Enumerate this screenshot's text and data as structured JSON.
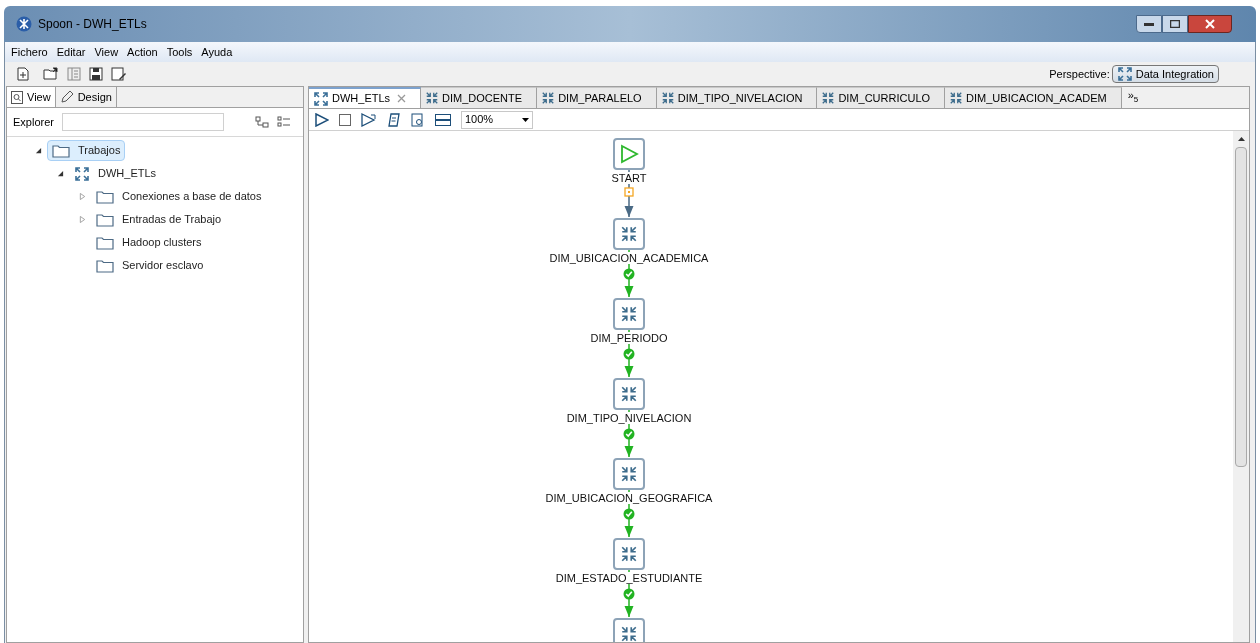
{
  "window": {
    "title": "Spoon - DWH_ETLs"
  },
  "menu": [
    "Fichero",
    "Editar",
    "View",
    "Action",
    "Tools",
    "Ayuda"
  ],
  "perspective": {
    "label": "Perspective:",
    "button": "Data Integration"
  },
  "left_tabs": [
    {
      "label": "View",
      "kind": "search",
      "selected": true
    },
    {
      "label": "Design",
      "kind": "pencil",
      "selected": false
    }
  ],
  "explorer": {
    "label": "Explorer"
  },
  "tree": [
    {
      "label": "Trabajos",
      "kind": "folder",
      "expanded": true,
      "selected": true,
      "children": [
        {
          "label": "DWH_ETLs",
          "kind": "job",
          "expanded": true,
          "selected": false,
          "children": [
            {
              "label": "Conexiones a base de datos",
              "kind": "folder",
              "expanded": false,
              "selected": false
            },
            {
              "label": "Entradas de Trabajo",
              "kind": "folder",
              "expanded": false,
              "selected": false
            },
            {
              "label": "Hadoop clusters",
              "kind": "folder",
              "selected": false
            },
            {
              "label": "Servidor esclavo",
              "kind": "folder",
              "selected": false
            }
          ]
        }
      ]
    }
  ],
  "tabs": [
    {
      "label": "DWH_ETLs",
      "kind": "job",
      "closable": true,
      "selected": true
    },
    {
      "label": "DIM_DOCENTE",
      "kind": "transform",
      "closable": false,
      "selected": false
    },
    {
      "label": "DIM_PARALELO",
      "kind": "transform",
      "closable": false,
      "selected": false
    },
    {
      "label": "DIM_TIPO_NIVELACION",
      "kind": "transform",
      "closable": false,
      "selected": false
    },
    {
      "label": "DIM_CURRICULO",
      "kind": "transform",
      "closable": false,
      "selected": false
    },
    {
      "label": "DIM_UBICACION_ACADEM",
      "kind": "transform",
      "closable": false,
      "selected": false
    }
  ],
  "tabs_overflow": {
    "symbol": "»",
    "count": "5"
  },
  "zoom": {
    "value": "100%"
  },
  "nodes": [
    {
      "kind": "start",
      "label": "START",
      "hop": {
        "kind": "unconditional"
      }
    },
    {
      "kind": "transform",
      "label": "DIM_UBICACION_ACADEMICA",
      "hop": {
        "kind": "success"
      }
    },
    {
      "kind": "transform",
      "label": "DIM_PERIODO",
      "hop": {
        "kind": "success"
      }
    },
    {
      "kind": "transform",
      "label": "DIM_TIPO_NIVELACION",
      "hop": {
        "kind": "success"
      }
    },
    {
      "kind": "transform",
      "label": "DIM_UBICACION_GEOGRAFICA",
      "hop": {
        "kind": "success"
      }
    },
    {
      "kind": "transform",
      "label": "DIM_ESTADO_ESTUDIANTE",
      "hop": {
        "kind": "success"
      }
    },
    {
      "kind": "transform"
    }
  ]
}
